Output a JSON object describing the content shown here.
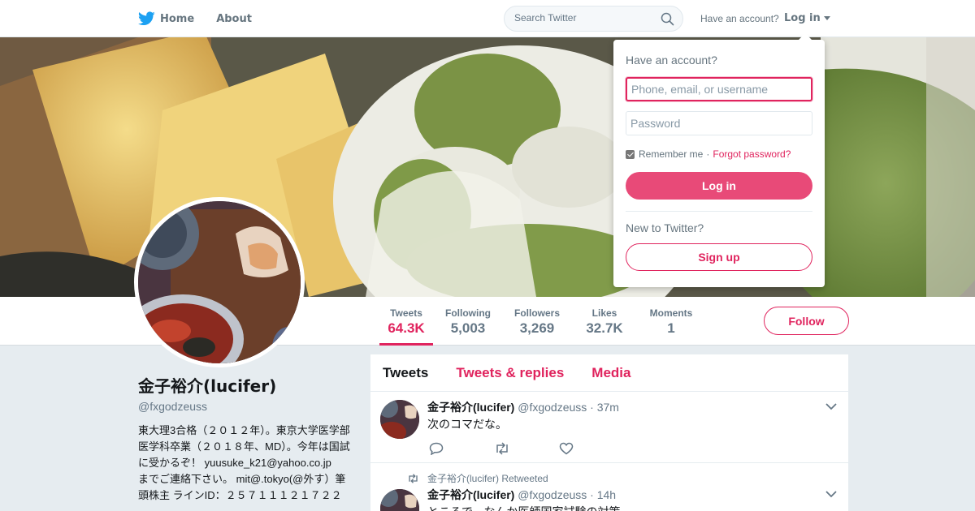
{
  "nav": {
    "home_label": "Home",
    "about_label": "About",
    "search_placeholder": "Search Twitter",
    "have_account": "Have an account?",
    "login_label": "Log in"
  },
  "profile": {
    "name": "金子裕介(lucifer)",
    "handle": "@fxgodzeuss",
    "bio": "東大理3合格（２０１２年）。東京大学医学部医学科卒業（２０１８年、MD）。今年は国試に受かるぞ！ yuusuke_k21@yahoo.co.jp　までご連絡下さい。 mit@.tokyo(@外す）筆頭株主 ラインID：２５７１１１２１７２２"
  },
  "stats": [
    {
      "label": "Tweets",
      "value": "64.3K",
      "active": true
    },
    {
      "label": "Following",
      "value": "5,003",
      "active": false
    },
    {
      "label": "Followers",
      "value": "3,269",
      "active": false
    },
    {
      "label": "Likes",
      "value": "32.7K",
      "active": false
    },
    {
      "label": "Moments",
      "value": "1",
      "active": false
    }
  ],
  "follow_label": "Follow",
  "timeline": {
    "tabs": [
      "Tweets",
      "Tweets & replies",
      "Media"
    ],
    "tweets": [
      {
        "name": "金子裕介(lucifer)",
        "handle": "@fxgodzeuss",
        "time": "· 37m",
        "text": "次のコマだな。"
      },
      {
        "retweet_context": "金子裕介(lucifer) Retweeted",
        "name": "金子裕介(lucifer)",
        "handle": "@fxgodzeuss",
        "time": "· 14h",
        "text": "ところで、なんか医師国家試験の対策"
      }
    ]
  },
  "login_dropdown": {
    "heading": "Have an account?",
    "username_placeholder": "Phone, email, or username",
    "password_placeholder": "Password",
    "remember_label": "Remember me",
    "separator": "·",
    "forgot_label": "Forgot password?",
    "login_button": "Log in",
    "new_heading": "New to Twitter?",
    "signup_button": "Sign up"
  },
  "colors": {
    "accent": "#e0245e",
    "twitter_blue": "#1da1f2",
    "login_button": "#e84a78"
  }
}
